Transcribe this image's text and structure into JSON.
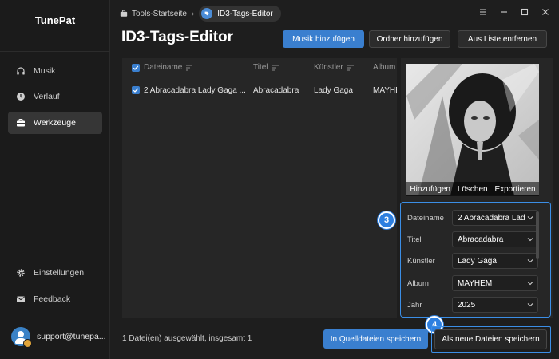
{
  "sidebar": {
    "brand": "TunePat",
    "items": [
      {
        "label": "Musik",
        "icon": "headphones-icon"
      },
      {
        "label": "Verlauf",
        "icon": "clock-icon"
      },
      {
        "label": "Werkzeuge",
        "icon": "toolbox-icon",
        "active": true
      }
    ],
    "bottom_items": [
      {
        "label": "Einstellungen",
        "icon": "gear-icon"
      },
      {
        "label": "Feedback",
        "icon": "mail-icon"
      }
    ],
    "user": "support@tunepa..."
  },
  "breadcrumb": {
    "home": "Tools-Startseite",
    "current": "ID3-Tags-Editor"
  },
  "page": {
    "title": "ID3-Tags-Editor"
  },
  "toolbar": {
    "add_music": "Musik hinzufügen",
    "add_folder": "Ordner hinzufügen",
    "remove_from_list": "Aus Liste entfernen"
  },
  "table": {
    "columns": [
      "Dateiname",
      "Titel",
      "Künstler",
      "Album"
    ],
    "rows": [
      {
        "filename": "2 Abracadabra Lady Gaga ...",
        "title": "Abracadabra",
        "artist": "Lady Gaga",
        "album": "MAYHEM"
      }
    ]
  },
  "cover": {
    "add": "Hinzufügen",
    "delete": "Löschen",
    "export": "Exportieren"
  },
  "tags": {
    "filename_label": "Dateiname",
    "filename_value": "2 Abracadabra Lad",
    "title_label": "Titel",
    "title_value": "Abracadabra",
    "artist_label": "Künstler",
    "artist_value": "Lady Gaga",
    "album_label": "Album",
    "album_value": "MAYHEM",
    "year_label": "Jahr",
    "year_value": "2025"
  },
  "steps": {
    "three": "3",
    "four": "4"
  },
  "footer": {
    "status": "1 Datei(en) ausgewählt, insgesamt 1",
    "save_source": "In Quelldateien speichern",
    "save_new": "Als neue Dateien speichern"
  },
  "colors": {
    "accent": "#3a7fcf",
    "highlight": "#3b8ee6",
    "background": "#1e1e1e"
  }
}
